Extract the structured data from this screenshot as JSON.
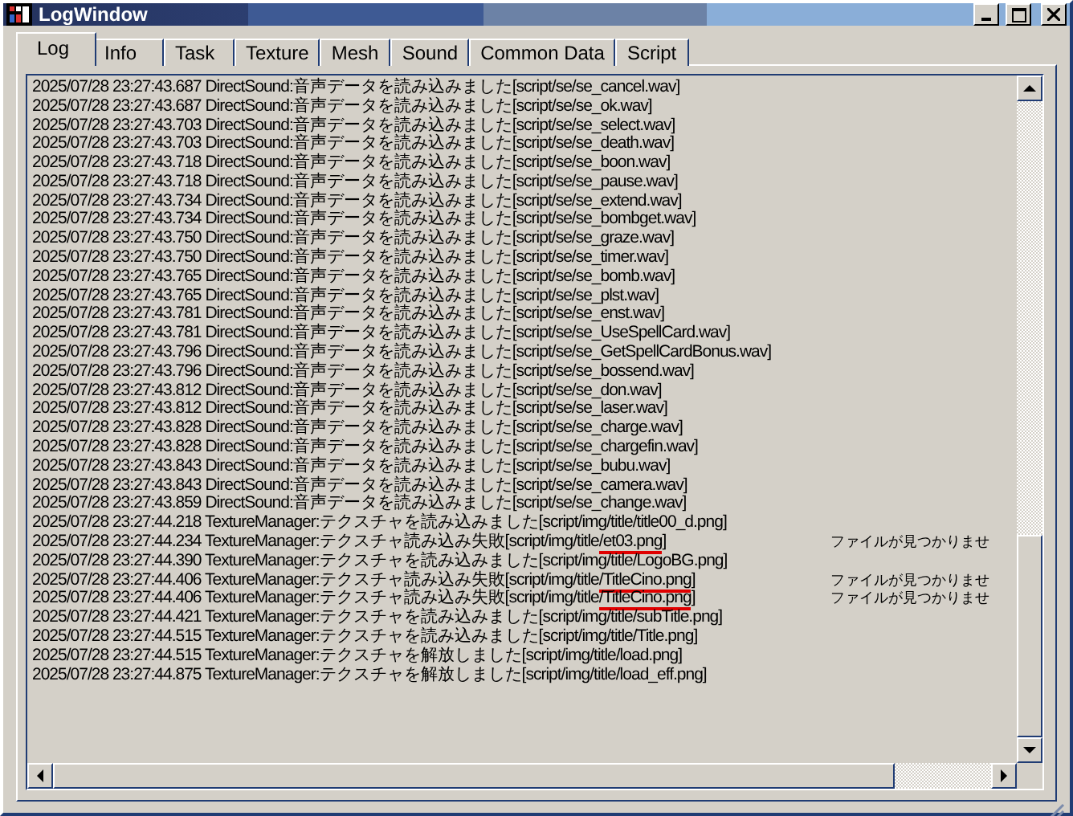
{
  "window": {
    "title": "LogWindow"
  },
  "tabs": [
    {
      "label": "Log",
      "selected": true
    },
    {
      "label": "Info",
      "selected": false
    },
    {
      "label": "Task",
      "selected": false
    },
    {
      "label": "Texture",
      "selected": false
    },
    {
      "label": "Mesh",
      "selected": false
    },
    {
      "label": "Sound",
      "selected": false
    },
    {
      "label": "Common Data",
      "selected": false
    },
    {
      "label": "Script",
      "selected": false
    }
  ],
  "log": [
    {
      "text": "2025/07/28 23:27:43.687 DirectSound:音声データを読み込みました[script/se/se_cancel.wav]"
    },
    {
      "text": "2025/07/28 23:27:43.687 DirectSound:音声データを読み込みました[script/se/se_ok.wav]"
    },
    {
      "text": "2025/07/28 23:27:43.703 DirectSound:音声データを読み込みました[script/se/se_select.wav]"
    },
    {
      "text": "2025/07/28 23:27:43.703 DirectSound:音声データを読み込みました[script/se/se_death.wav]"
    },
    {
      "text": "2025/07/28 23:27:43.718 DirectSound:音声データを読み込みました[script/se/se_boon.wav]"
    },
    {
      "text": "2025/07/28 23:27:43.718 DirectSound:音声データを読み込みました[script/se/se_pause.wav]"
    },
    {
      "text": "2025/07/28 23:27:43.734 DirectSound:音声データを読み込みました[script/se/se_extend.wav]"
    },
    {
      "text": "2025/07/28 23:27:43.734 DirectSound:音声データを読み込みました[script/se/se_bombget.wav]"
    },
    {
      "text": "2025/07/28 23:27:43.750 DirectSound:音声データを読み込みました[script/se/se_graze.wav]"
    },
    {
      "text": "2025/07/28 23:27:43.750 DirectSound:音声データを読み込みました[script/se/se_timer.wav]"
    },
    {
      "text": "2025/07/28 23:27:43.765 DirectSound:音声データを読み込みました[script/se/se_bomb.wav]"
    },
    {
      "text": "2025/07/28 23:27:43.765 DirectSound:音声データを読み込みました[script/se/se_plst.wav]"
    },
    {
      "text": "2025/07/28 23:27:43.781 DirectSound:音声データを読み込みました[script/se/se_enst.wav]"
    },
    {
      "text": "2025/07/28 23:27:43.781 DirectSound:音声データを読み込みました[script/se/se_UseSpellCard.wav]"
    },
    {
      "text": "2025/07/28 23:27:43.796 DirectSound:音声データを読み込みました[script/se/se_GetSpellCardBonus.wav]"
    },
    {
      "text": "2025/07/28 23:27:43.796 DirectSound:音声データを読み込みました[script/se/se_bossend.wav]"
    },
    {
      "text": "2025/07/28 23:27:43.812 DirectSound:音声データを読み込みました[script/se/se_don.wav]"
    },
    {
      "text": "2025/07/28 23:27:43.812 DirectSound:音声データを読み込みました[script/se/se_laser.wav]"
    },
    {
      "text": "2025/07/28 23:27:43.828 DirectSound:音声データを読み込みました[script/se/se_charge.wav]"
    },
    {
      "text": "2025/07/28 23:27:43.828 DirectSound:音声データを読み込みました[script/se/se_chargefin.wav]"
    },
    {
      "text": "2025/07/28 23:27:43.843 DirectSound:音声データを読み込みました[script/se/se_bubu.wav]"
    },
    {
      "text": "2025/07/28 23:27:43.843 DirectSound:音声データを読み込みました[script/se/se_camera.wav]"
    },
    {
      "text": "2025/07/28 23:27:43.859 DirectSound:音声データを読み込みました[script/se/se_change.wav]"
    },
    {
      "text": "2025/07/28 23:27:44.218 TextureManager:テクスチャを読み込みました[script/img/title/title00_d.png]"
    },
    {
      "text": "2025/07/28 23:27:44.234 TextureManager:テクスチャ読み込み失敗[script/img/title",
      "marked": "/et03.png",
      "after": "]",
      "note": "ファイルが見つかりませ"
    },
    {
      "text": "2025/07/28 23:27:44.390 TextureManager:テクスチャを読み込みました[script/img/title/LogoBG.png]"
    },
    {
      "text": "2025/07/28 23:27:44.406 TextureManager:テクスチャ読み込み失敗[script/img/title",
      "marked": "/TitleCino.png",
      "after": "]",
      "note": "ファイルが見つかりませ"
    },
    {
      "text": "2025/07/28 23:27:44.406 TextureManager:テクスチャ読み込み失敗[script/img/title",
      "marked": "/TitleCino.png",
      "after": "]",
      "note": "ファイルが見つかりませ"
    },
    {
      "text": "2025/07/28 23:27:44.421 TextureManager:テクスチャを読み込みました[script/img/title/subTitle.png]"
    },
    {
      "text": "2025/07/28 23:27:44.515 TextureManager:テクスチャを読み込みました[script/img/title/Title.png]"
    },
    {
      "text": "2025/07/28 23:27:44.515 TextureManager:テクスチャを解放しました[script/img/title/load.png]"
    },
    {
      "text": "2025/07/28 23:27:44.875 TextureManager:テクスチャを解放しました[script/img/title/load_eff.png]"
    }
  ]
}
